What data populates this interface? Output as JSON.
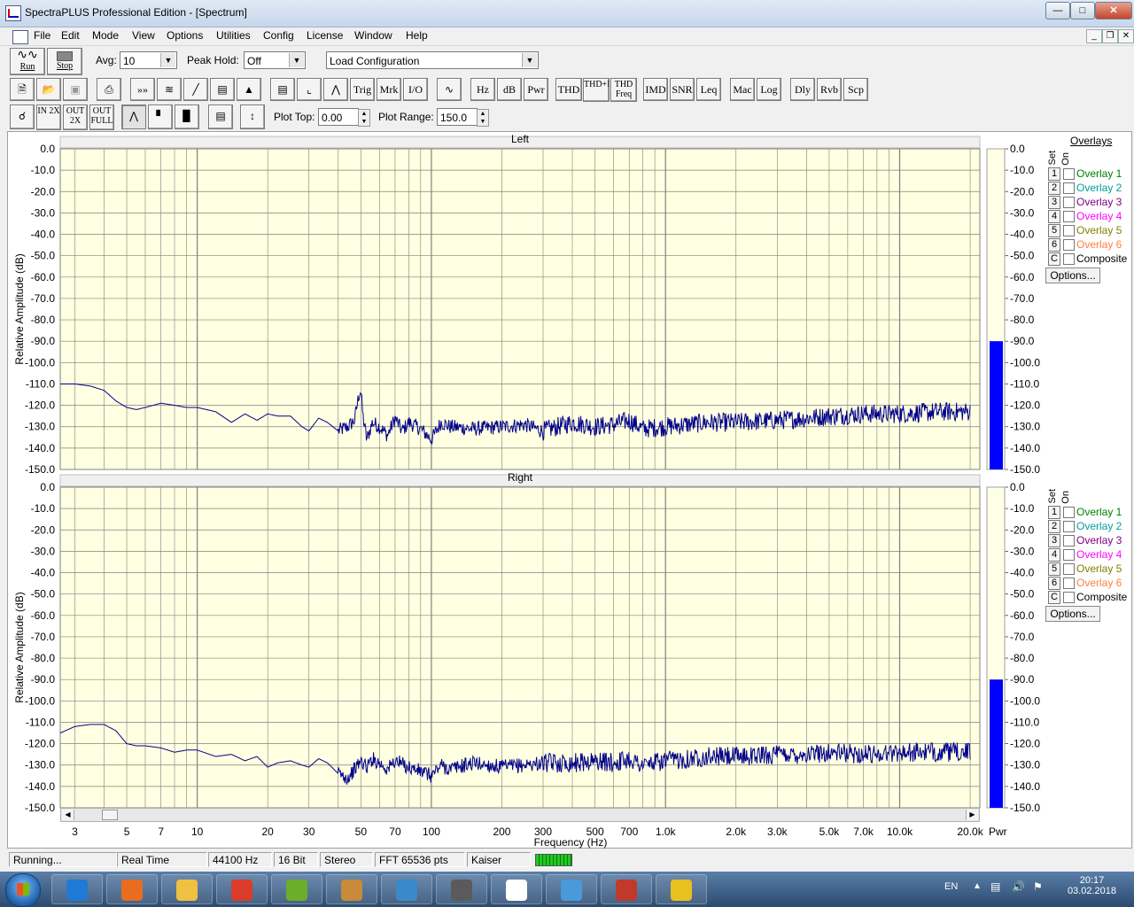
{
  "window": {
    "title": "SpectraPLUS Professional Edition - [Spectrum]"
  },
  "menu": [
    "File",
    "Edit",
    "Mode",
    "View",
    "Options",
    "Utilities",
    "Config",
    "License",
    "Window",
    "Help"
  ],
  "toolbar1": {
    "run_label": "Run",
    "stop_label": "Stop",
    "avg_label": "Avg:",
    "avg_value": "10",
    "peak_label": "Peak Hold:",
    "peak_value": "Off",
    "config_value": "Load Configuration"
  },
  "toolbar2": {
    "text_buttons": [
      "Trig",
      "Mrk",
      "I/O",
      "Hz",
      "dB",
      "Pwr",
      "THD",
      "THD+N",
      "THD Freq",
      "IMD",
      "SNR",
      "Leq",
      "Mac",
      "Log",
      "Dly",
      "Rvb",
      "Scp"
    ]
  },
  "toolbar3": {
    "zoom_in": "IN 2X",
    "zoom_out": "OUT 2X",
    "zoom_full": "OUT FULL",
    "plot_top_label": "Plot Top:",
    "plot_top_value": "0.00",
    "plot_range_label": "Plot Range:",
    "plot_range_value": "150.0"
  },
  "plot": {
    "xlabel": "Frequency (Hz)",
    "ylabel": "Relative Amplitude (dB)",
    "x_ticks": [
      "3",
      "5",
      "7",
      "10",
      "20",
      "30",
      "50",
      "70",
      "100",
      "200",
      "300",
      "500",
      "700",
      "1.0k",
      "2.0k",
      "3.0k",
      "5.0k",
      "7.0k",
      "10.0k",
      "20.0k"
    ],
    "x_tick_values": [
      3,
      5,
      7,
      10,
      20,
      30,
      50,
      70,
      100,
      200,
      300,
      500,
      700,
      1000,
      2000,
      3000,
      5000,
      7000,
      10000,
      20000
    ],
    "y_ticks": [
      "0.0",
      "-10.0",
      "-20.0",
      "-30.0",
      "-40.0",
      "-50.0",
      "-60.0",
      "-70.0",
      "-80.0",
      "-90.0",
      "-100.0",
      "-110.0",
      "-120.0",
      "-130.0",
      "-140.0",
      "-150.0"
    ],
    "pwr_label": "Pwr",
    "colors": {
      "trace": "#00008b",
      "background": "#ffffe1",
      "grid": "#808080",
      "meter": "#0000ff"
    }
  },
  "chart_data": [
    {
      "type": "line",
      "title": "Left",
      "xlabel": "Frequency (Hz)",
      "ylabel": "Relative Amplitude (dB)",
      "xscale": "log",
      "xlim": [
        2.6,
        22000
      ],
      "ylim": [
        -150,
        0
      ],
      "series": [
        {
          "x": [
            2.6,
            3,
            3.5,
            4,
            4.5,
            5,
            5.5,
            6,
            7,
            8,
            9,
            10,
            12,
            14,
            16,
            18,
            20,
            22,
            25,
            28,
            30,
            33,
            36,
            40,
            44,
            47,
            49,
            50,
            51,
            53,
            56,
            60,
            65,
            70,
            75,
            80,
            90,
            100,
            110,
            120,
            150,
            200,
            250,
            300,
            400,
            500,
            600,
            700,
            800,
            1000,
            1500,
            2000,
            3000,
            4000,
            5000,
            7000,
            10000,
            15000,
            20000
          ],
          "y": [
            -110,
            -110,
            -111,
            -113,
            -118,
            -121,
            -122,
            -121,
            -119,
            -120,
            -121,
            -121,
            -123,
            -128,
            -124,
            -127,
            -124,
            -125,
            -125,
            -130,
            -132,
            -126,
            -128,
            -132,
            -130,
            -127,
            -115,
            -113,
            -125,
            -136,
            -128,
            -130,
            -134,
            -126,
            -132,
            -128,
            -131,
            -136,
            -128,
            -130,
            -131,
            -130,
            -129,
            -132,
            -128,
            -130,
            -129,
            -127,
            -131,
            -130,
            -128,
            -128,
            -127,
            -126,
            -125,
            -124,
            -124,
            -123,
            -123
          ]
        }
      ],
      "meter_level_db": -90
    },
    {
      "type": "line",
      "title": "Right",
      "xlabel": "Frequency (Hz)",
      "ylabel": "Relative Amplitude (dB)",
      "xscale": "log",
      "xlim": [
        2.6,
        22000
      ],
      "ylim": [
        -150,
        0
      ],
      "series": [
        {
          "x": [
            2.6,
            3,
            3.5,
            4,
            4.5,
            5,
            5.5,
            6,
            7,
            8,
            9,
            10,
            12,
            14,
            16,
            18,
            20,
            22,
            25,
            28,
            30,
            33,
            36,
            40,
            44,
            47,
            50,
            53,
            56,
            60,
            65,
            70,
            80,
            90,
            100,
            110,
            120,
            150,
            200,
            250,
            300,
            400,
            500,
            600,
            700,
            800,
            1000,
            1500,
            2000,
            3000,
            4000,
            5000,
            7000,
            10000,
            15000,
            20000
          ],
          "y": [
            -115,
            -112,
            -111,
            -111,
            -114,
            -120,
            -121,
            -121,
            -122,
            -124,
            -123,
            -123,
            -126,
            -125,
            -128,
            -126,
            -131,
            -129,
            -128,
            -130,
            -131,
            -127,
            -129,
            -134,
            -136,
            -132,
            -128,
            -131,
            -127,
            -129,
            -132,
            -128,
            -131,
            -133,
            -135,
            -130,
            -132,
            -129,
            -131,
            -130,
            -129,
            -129,
            -128,
            -129,
            -127,
            -130,
            -128,
            -126,
            -126,
            -125,
            -125,
            -124,
            -125,
            -124,
            -124,
            -124
          ]
        }
      ],
      "meter_level_db": -90
    }
  ],
  "overlays": {
    "header": "Overlays",
    "set_label": "Set",
    "on_label": "On",
    "items": [
      {
        "set": "1",
        "label": "Overlay 1",
        "color": "#008000"
      },
      {
        "set": "2",
        "label": "Overlay 2",
        "color": "#00a0a0"
      },
      {
        "set": "3",
        "label": "Overlay 3",
        "color": "#800080"
      },
      {
        "set": "4",
        "label": "Overlay 4",
        "color": "#ff00ff"
      },
      {
        "set": "5",
        "label": "Overlay 5",
        "color": "#808000"
      },
      {
        "set": "6",
        "label": "Overlay 6",
        "color": "#ff8040"
      },
      {
        "set": "C",
        "label": "Composite",
        "color": "#000000"
      }
    ],
    "options_label": "Options..."
  },
  "status": [
    "Running...",
    "Real Time",
    "44100 Hz",
    "16 Bit",
    "Stereo",
    "FFT 65536 pts",
    "Kaiser"
  ],
  "taskbar": {
    "lang": "EN",
    "time": "20:17",
    "date": "03.02.2018",
    "apps": [
      "internet-explorer",
      "media-player",
      "file-explorer",
      "chrome",
      "utorrent",
      "paint",
      "photo-viewer",
      "m-app",
      "spectraplus",
      "control-panel",
      "toolbox",
      "video-editor"
    ]
  }
}
